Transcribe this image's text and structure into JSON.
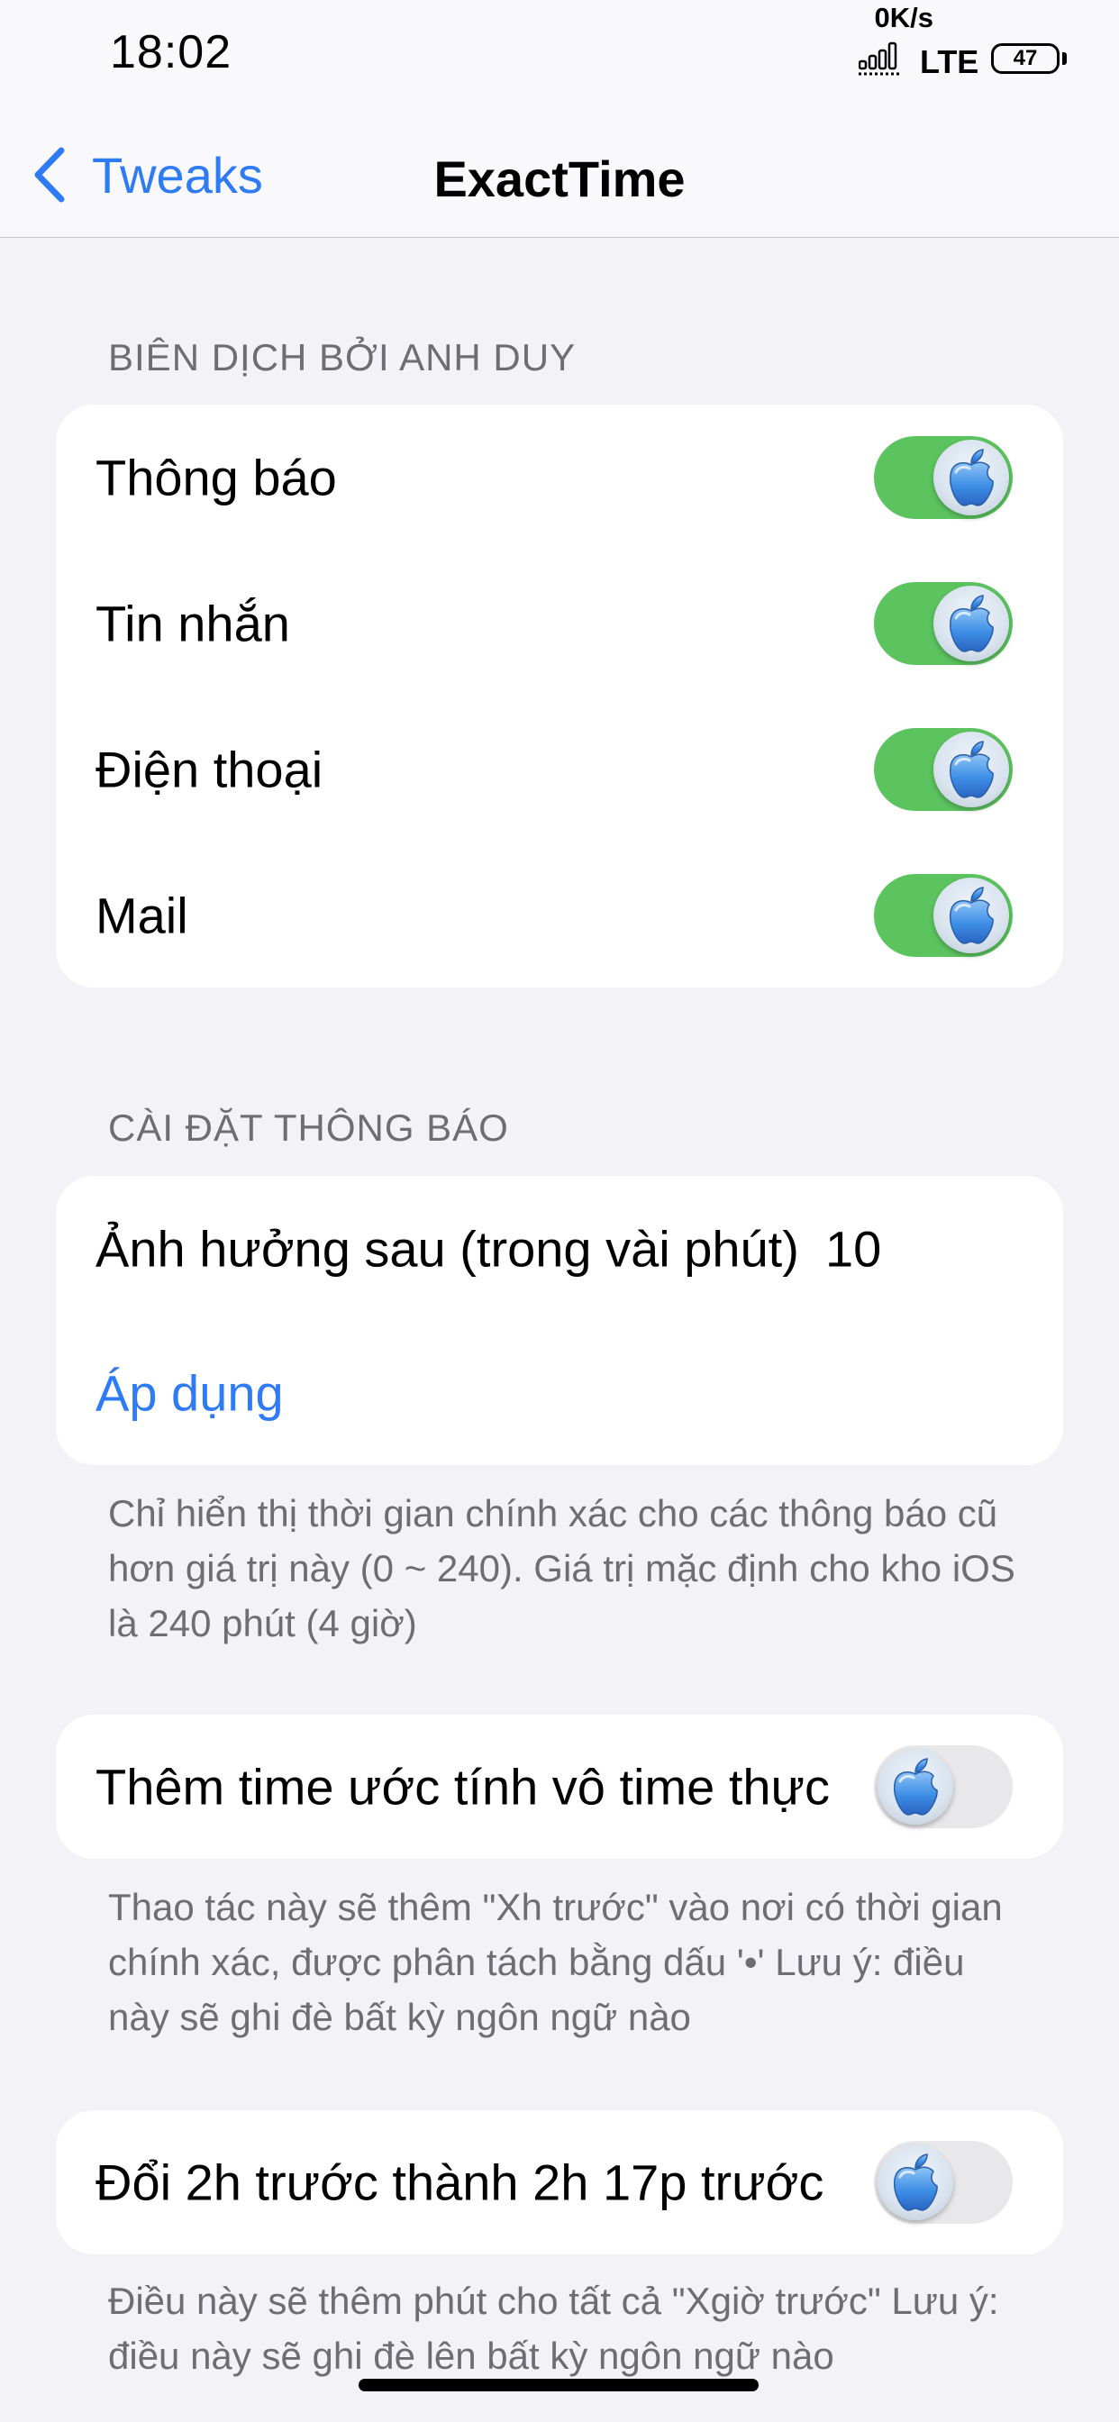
{
  "status_bar": {
    "time": "18:02",
    "net_speed": "0K/s",
    "network": "LTE",
    "battery": "47"
  },
  "nav": {
    "back_label": "Tweaks",
    "title": "ExactTime"
  },
  "section1": {
    "header": "BIÊN DỊCH BỞI ANH DUY",
    "rows": [
      {
        "label": "Thông báo",
        "on": true
      },
      {
        "label": "Tin nhắn",
        "on": true
      },
      {
        "label": "Điện thoại",
        "on": true
      },
      {
        "label": "Mail",
        "on": true
      }
    ]
  },
  "section2": {
    "header": "CÀI ĐẶT THÔNG BÁO",
    "delay_label": "Ảnh hưởng sau (trong vài phút)",
    "delay_value": "10",
    "apply_label": "Áp dụng",
    "footer": "Chỉ hiển thị thời gian chính xác cho các thông báo cũ hơn giá trị này (0 ~ 240). Giá trị mặc định cho kho iOS là 240 phút (4 giờ)"
  },
  "section3": {
    "label": "Thêm time ước tính vô time thực",
    "on": false,
    "footer": "Thao tác này sẽ thêm \"Xh trước\" vào nơi có thời gian chính xác, được phân tách bằng dấu '•' Lưu ý: điều này sẽ ghi đè bất kỳ ngôn ngữ nào"
  },
  "section4": {
    "label": "Đổi 2h trước thành 2h 17p trước",
    "on": false,
    "footer": "Điều này sẽ thêm phút cho tất cả \"Xgiờ trước\" Lưu ý: điều này sẽ ghi đè lên bất kỳ ngôn ngữ nào"
  },
  "colors": {
    "accent": "#2f7bf5",
    "toggle_on": "#5cc45f",
    "toggle_off": "#e8e8ea",
    "background": "#f2f2f7"
  },
  "icons": [
    "chevron-left-icon",
    "signal-icon",
    "battery-icon",
    "apple-logo-icon"
  ]
}
